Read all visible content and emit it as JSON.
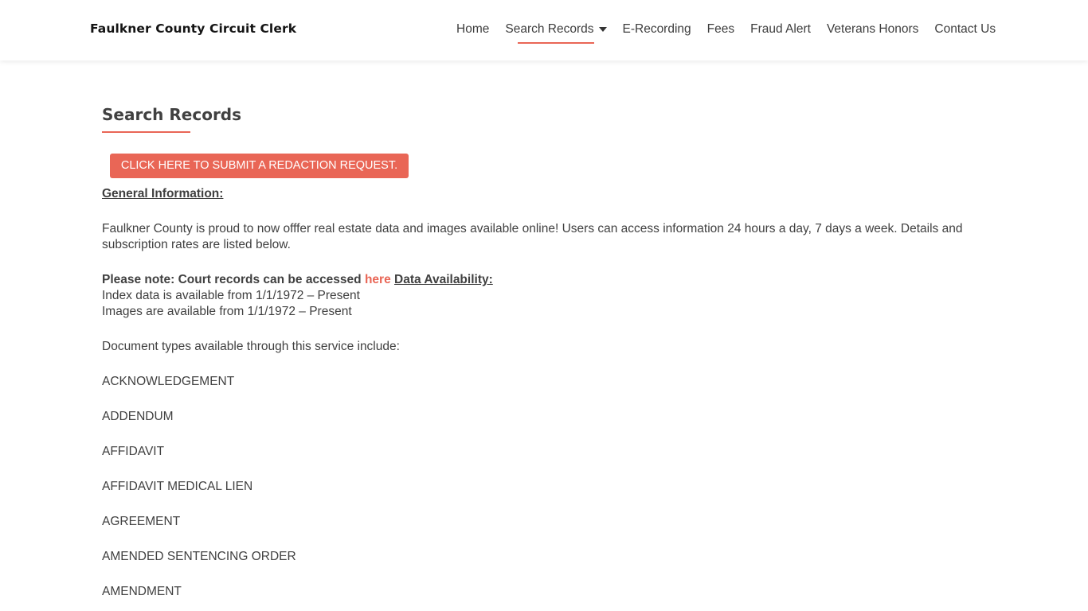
{
  "header": {
    "site_title": "Faulkner County Circuit Clerk",
    "nav": [
      {
        "label": "Home"
      },
      {
        "label": "Search Records"
      },
      {
        "label": "E-Recording"
      },
      {
        "label": "Fees"
      },
      {
        "label": "Fraud Alert"
      },
      {
        "label": "Veterans Honors"
      },
      {
        "label": "Contact Us"
      }
    ],
    "accent_color": "#e96656"
  },
  "main": {
    "page_title": "Search Records",
    "redaction_button": "CLICK HERE TO SUBMIT A REDACTION REQUEST.",
    "general_info_heading": "General Information:",
    "intro": "Faulkner County is proud to now offfer real estate data and images available online!  Users can access information 24 hours a day, 7 days a week. Details and subscription rates are listed below.",
    "note_prefix": "Please note:  Court records can be accessed ",
    "note_link": "here",
    "data_availability_heading": "Data Availability:",
    "index_data": "Index data is available from 1/1/1972 – Present",
    "images_data": "Images are available from 1/1/1972 – Present",
    "doc_types_intro": "Document types available through this service include:",
    "doc_types": [
      "ACKNOWLEDGEMENT",
      "ADDENDUM",
      "AFFIDAVIT",
      "AFFIDAVIT MEDICAL LIEN",
      "AGREEMENT",
      "AMENDED SENTENCING ORDER",
      "AMENDMENT"
    ]
  }
}
